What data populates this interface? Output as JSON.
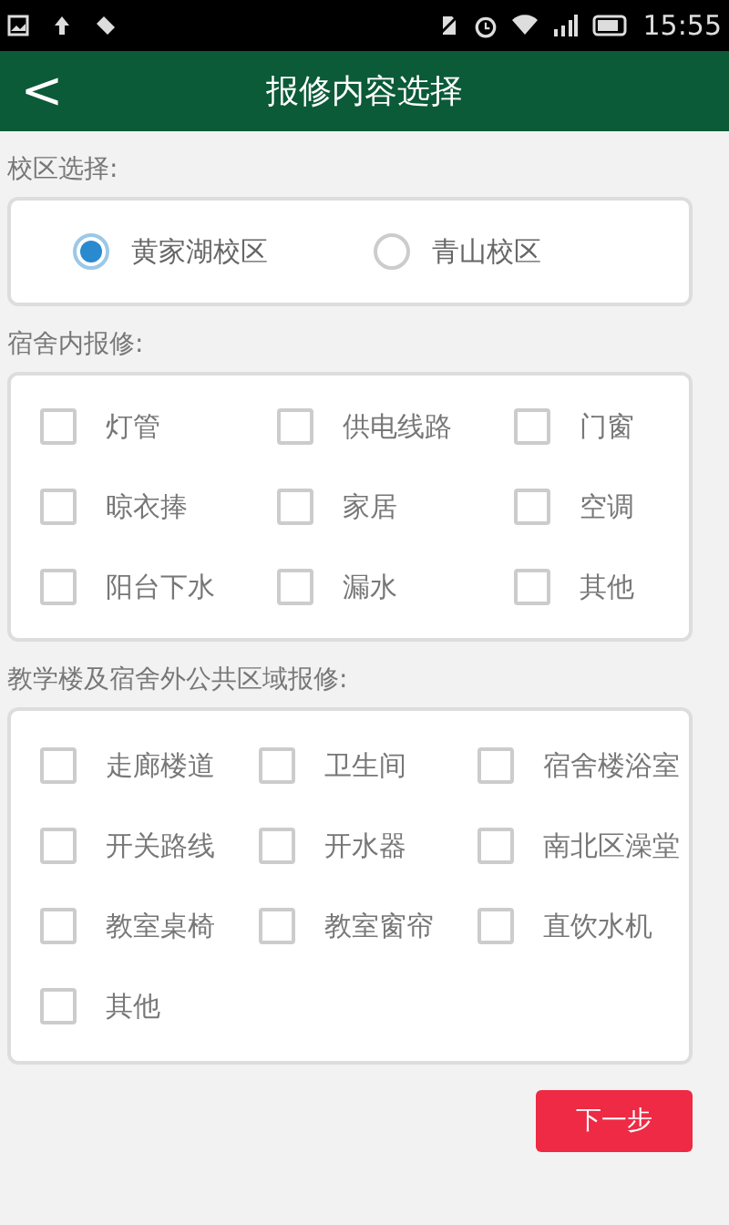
{
  "status_bar": {
    "time": "15:55"
  },
  "header": {
    "back": "<",
    "title": "报修内容选择"
  },
  "sections": [
    {
      "kind": "radio",
      "label": "校区选择:",
      "options": [
        {
          "label": "黄家湖校区",
          "selected": true
        },
        {
          "label": "青山校区",
          "selected": false
        }
      ]
    },
    {
      "kind": "checkbox",
      "label": "宿舍内报修:",
      "options": [
        {
          "label": "灯管",
          "checked": false
        },
        {
          "label": "供电线路",
          "checked": false
        },
        {
          "label": "门窗",
          "checked": false
        },
        {
          "label": "晾衣捧",
          "checked": false
        },
        {
          "label": "家居",
          "checked": false
        },
        {
          "label": "空调",
          "checked": false
        },
        {
          "label": "阳台下水",
          "checked": false
        },
        {
          "label": "漏水",
          "checked": false
        },
        {
          "label": "其他",
          "checked": false
        }
      ]
    },
    {
      "kind": "checkbox",
      "label": "教学楼及宿舍外公共区域报修:",
      "options": [
        {
          "label": "走廊楼道",
          "checked": false
        },
        {
          "label": "卫生间",
          "checked": false
        },
        {
          "label": "宿舍楼浴室",
          "checked": false
        },
        {
          "label": "开关路线",
          "checked": false
        },
        {
          "label": "开水器",
          "checked": false
        },
        {
          "label": "南北区澡堂",
          "checked": false
        },
        {
          "label": "教室桌椅",
          "checked": false
        },
        {
          "label": "教室窗帘",
          "checked": false
        },
        {
          "label": "直饮水机",
          "checked": false
        },
        {
          "label": "其他",
          "checked": false
        }
      ]
    }
  ],
  "next_button": "下一步"
}
